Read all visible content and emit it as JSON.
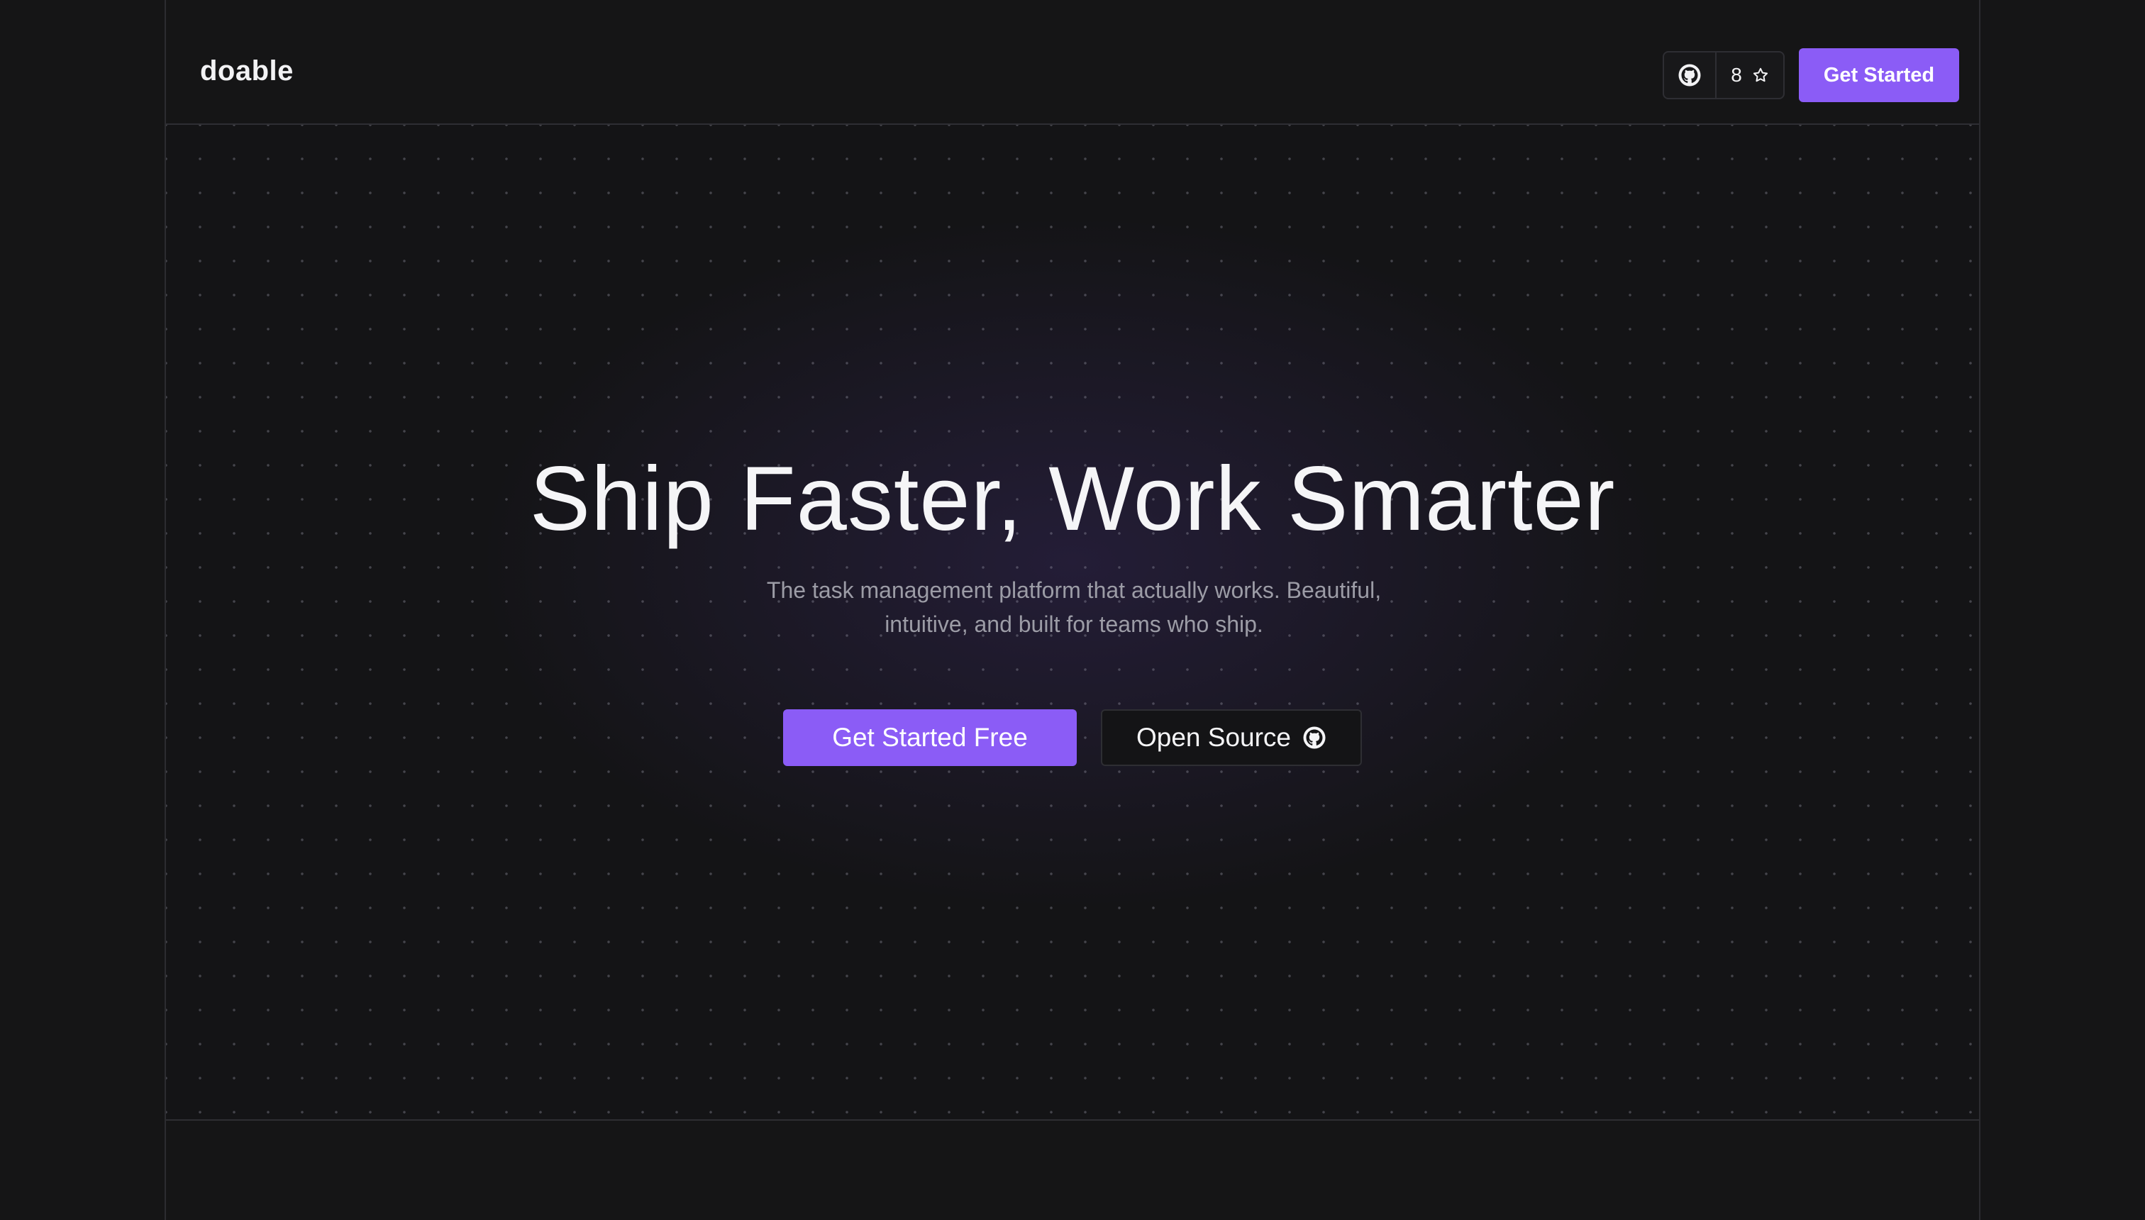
{
  "header": {
    "logo": "doable",
    "github": {
      "icon": "github-icon",
      "star_count": "8",
      "star_icon": "star-icon"
    },
    "cta_label": "Get Started"
  },
  "hero": {
    "title": "Ship Faster, Work Smarter",
    "subtitle_line1": "The task management platform that actually works. Beautiful,",
    "subtitle_line2": "intuitive, and built for teams who ship.",
    "primary_cta": "Get Started Free",
    "secondary_cta": "Open Source",
    "secondary_icon": "github-icon"
  },
  "colors": {
    "background": "#151516",
    "accent": "#8b5cf6",
    "border": "#2e2e33",
    "muted_text": "#9c9ca6"
  }
}
